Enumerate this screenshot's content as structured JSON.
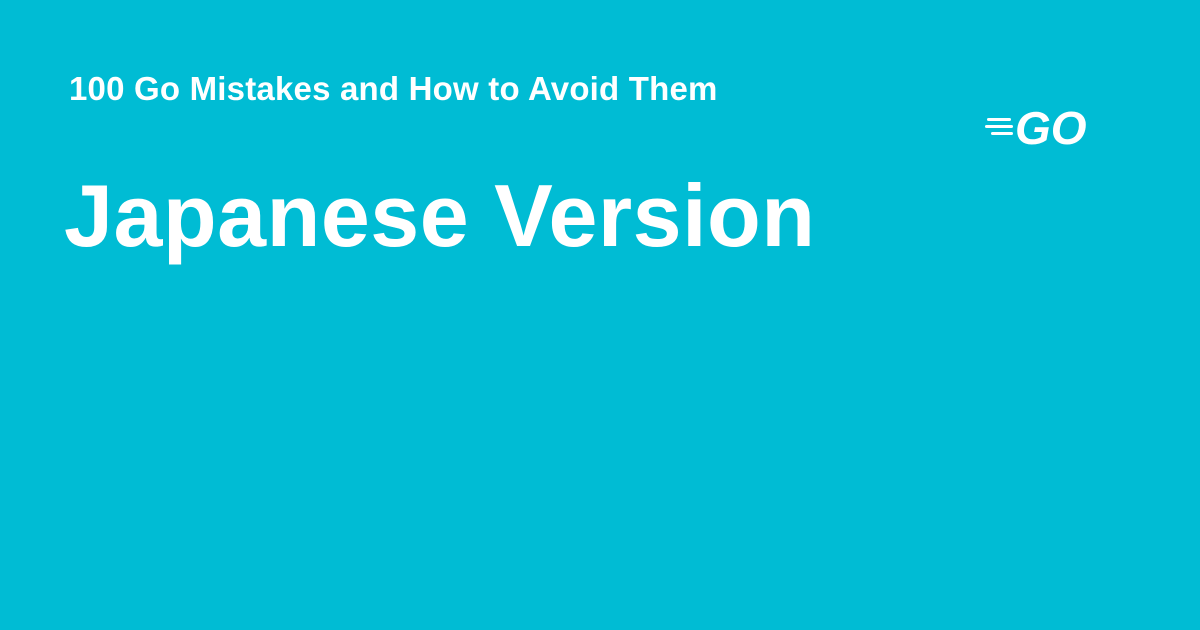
{
  "card": {
    "subtitle": "100 Go Mistakes and How to Avoid Them",
    "title": "Japanese Version",
    "logo_text": "GO",
    "background_color": "#00BCD4",
    "text_color": "#FFFFFF",
    "logo_icon": "go-gopher-speed-logo-icon"
  }
}
